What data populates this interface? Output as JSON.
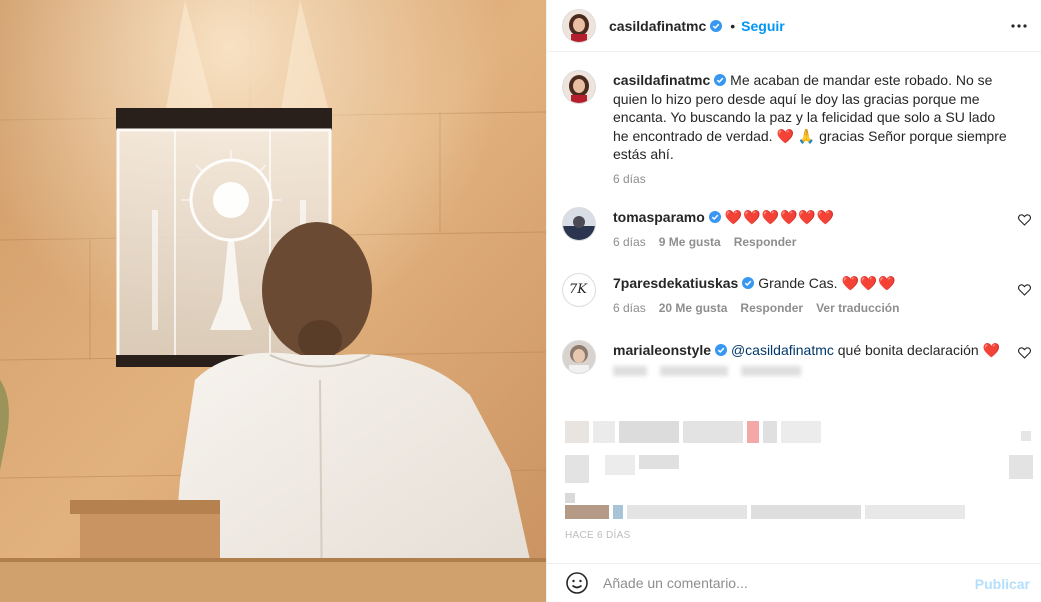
{
  "post": {
    "author": "casildafinatmc",
    "follow_label": "Seguir",
    "separator": "•",
    "more_icon": "more-horizontal-icon"
  },
  "caption": {
    "username": "casildafinatmc",
    "text": "Me acaban de mandar este robado. No se quien lo hizo pero desde aquí le doy las gracias porque me encanta. Yo buscando la paz y la felicidad que solo a SU lado he encontrado de verdad. ❤️ 🙏 gracias Señor porque siempre estás ahí.",
    "time": "6 días"
  },
  "comments": [
    {
      "username": "tomasparamo",
      "verified": true,
      "text": "❤️❤️❤️❤️❤️❤️",
      "time": "6 días",
      "likes": "9 Me gusta",
      "reply": "Responder"
    },
    {
      "username": "7paresdekatiuskas",
      "verified": true,
      "text_plain": "Grande Cas.",
      "text_hearts": "❤️❤️❤️",
      "time": "6 días",
      "likes": "20 Me gusta",
      "reply": "Responder",
      "translate": "Ver traducción",
      "avatar_text": "7K"
    },
    {
      "username": "marialeonstyle",
      "verified": true,
      "mention": "@casildafinatmc",
      "text_plain": "qué bonita declaración",
      "text_hearts": "❤️"
    }
  ],
  "footer": {
    "time_partial": "HACE 6 DÍAS"
  },
  "add_comment": {
    "placeholder": "Añade un comentario...",
    "publish_label": "Publicar",
    "emoji_icon": "smiley-icon"
  },
  "colors": {
    "accent": "#0095f6",
    "publish_disabled": "#b2dffc",
    "secondary_text": "#8e8e8e",
    "heart": "#ed1c24",
    "verified": "#3897f0"
  }
}
